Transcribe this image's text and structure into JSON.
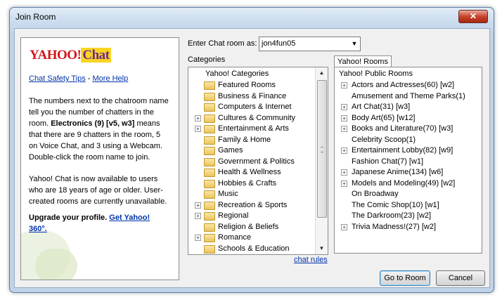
{
  "window": {
    "title": "Join Room",
    "close_glyph": "✕"
  },
  "left_panel": {
    "logo_text_1": "YAHOO!",
    "logo_text_2": "Chat",
    "safety_link": "Chat Safety Tips",
    "separator": " - ",
    "help_link": "More Help",
    "paragraph_1_pre": "The numbers next to the chatroom name tell you the number of chatters in the room. ",
    "paragraph_1_bold": "Electronics (9) [v5, w3]",
    "paragraph_1_post": " means that there are 9 chatters in the room, 5 on Voice Chat, and 3 using a Webcam. Double-click the room name to join.",
    "paragraph_2": "Yahoo! Chat is now available to users who are 18 years of age or older. User-created rooms are currently unavailable.",
    "upgrade_text": "Upgrade your profile. ",
    "upgrade_link": "Get Yahoo! 360°."
  },
  "enter_as": {
    "label": "Enter Chat room as:",
    "value": "jon4fun05"
  },
  "categories": {
    "label": "Categories",
    "root": "Yahoo! Categories",
    "items": [
      {
        "label": "Featured Rooms",
        "expandable": false
      },
      {
        "label": "Business & Finance",
        "expandable": false
      },
      {
        "label": "Computers & Internet",
        "expandable": false
      },
      {
        "label": "Cultures & Community",
        "expandable": true
      },
      {
        "label": "Entertainment & Arts",
        "expandable": true
      },
      {
        "label": "Family & Home",
        "expandable": false
      },
      {
        "label": "Games",
        "expandable": false
      },
      {
        "label": "Government & Politics",
        "expandable": false
      },
      {
        "label": "Health & Wellness",
        "expandable": false
      },
      {
        "label": "Hobbies & Crafts",
        "expandable": false
      },
      {
        "label": "Music",
        "expandable": false
      },
      {
        "label": "Recreation & Sports",
        "expandable": true
      },
      {
        "label": "Regional",
        "expandable": true
      },
      {
        "label": "Religion & Beliefs",
        "expandable": false
      },
      {
        "label": "Romance",
        "expandable": true
      },
      {
        "label": "Schools & Education",
        "expandable": false
      }
    ]
  },
  "chat_rules": "chat rules",
  "rooms": {
    "tab": "Yahoo! Rooms",
    "root": "Yahoo! Public Rooms",
    "items": [
      {
        "label": "Actors and Actresses(60) [w2]",
        "expandable": true
      },
      {
        "label": "Amusement and Theme Parks(1)",
        "expandable": false
      },
      {
        "label": "Art Chat(31) [w3]",
        "expandable": true
      },
      {
        "label": "Body Art(65) [w12]",
        "expandable": true
      },
      {
        "label": "Books and Literature(70) [w3]",
        "expandable": true
      },
      {
        "label": "Celebrity Scoop(1)",
        "expandable": false
      },
      {
        "label": "Entertainment Lobby(82) [w9]",
        "expandable": true
      },
      {
        "label": "Fashion Chat(7) [w1]",
        "expandable": false
      },
      {
        "label": "Japanese Anime(134) [w6]",
        "expandable": true
      },
      {
        "label": "Models and Modeling(49) [w2]",
        "expandable": true
      },
      {
        "label": "On Broadway",
        "expandable": false
      },
      {
        "label": "The Comic Shop(10) [w1]",
        "expandable": false
      },
      {
        "label": "The Darkroom(23) [w2]",
        "expandable": false
      },
      {
        "label": "Trivia Madness!(27) [w2]",
        "expandable": true
      }
    ]
  },
  "buttons": {
    "go": "Go to Room",
    "cancel": "Cancel"
  },
  "glyphs": {
    "expander": "+",
    "dropdown": "▼",
    "up": "▲",
    "down": "▼"
  }
}
